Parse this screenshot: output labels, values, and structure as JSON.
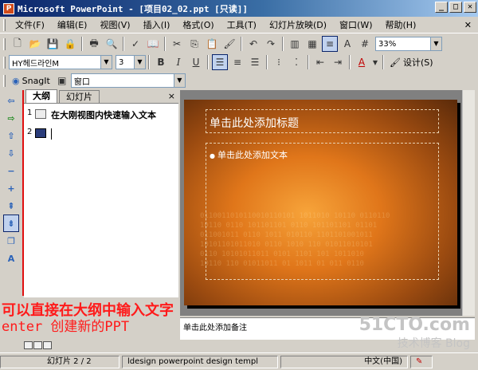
{
  "window": {
    "title": "Microsoft PowerPoint - [项目02_02.ppt [只读]]",
    "app_icon": "P",
    "buttons": [
      "_",
      "□",
      "✕"
    ]
  },
  "menu": {
    "items": [
      "文件(F)",
      "编辑(E)",
      "视图(V)",
      "插入(I)",
      "格式(O)",
      "工具(T)",
      "幻灯片放映(D)",
      "窗口(W)",
      "帮助(H)"
    ],
    "close_glyph": "✕"
  },
  "standard_toolbar": {
    "zoom": "33%"
  },
  "format_toolbar": {
    "font": "HY헤드라인M",
    "size": "3",
    "bold": "B",
    "italic": "I",
    "underline": "U",
    "font_color": "A",
    "design_label": "设计(S)"
  },
  "snagit_toolbar": {
    "snagit_label": "SnagIt",
    "window_combo": "窗口"
  },
  "outline_pane": {
    "tabs": [
      "大纲",
      "幻灯片"
    ],
    "close_glyph": "×",
    "rows": [
      {
        "num": "1",
        "text": "在大刚视图内快速输入文本"
      },
      {
        "num": "2",
        "text": ""
      }
    ]
  },
  "slide": {
    "title_placeholder": "单击此处添加标题",
    "body_placeholder": "单击此处添加文本",
    "bullet": "●",
    "bits": "0110011010110010110101 1011010 10110 0110110\n10110 0110 101101101 0110 101101101 01101\n011001011 0110 1011 010110 1101101001011\n10101101011010 0110 1010 110 01011010101\n0110 10101011011 0101 1101 101 1011010\n10110 110 01011011 01 1011 01 011 0110"
  },
  "notes": {
    "placeholder": "单击此处添加备注"
  },
  "annotation": {
    "line1": "可以直接在大纲中输入文字",
    "line2": "enter 创建新的PPT"
  },
  "watermark": {
    "site": "51CTO.com",
    "sub": "技术博客 Blog"
  },
  "status": {
    "slide": "幻灯片 2 / 2",
    "template": "ldesign powerpoint design templ",
    "language": "中文(中国)"
  },
  "colors": {
    "annotation": "#ff1a1a",
    "title_bar": "#0a246a"
  }
}
